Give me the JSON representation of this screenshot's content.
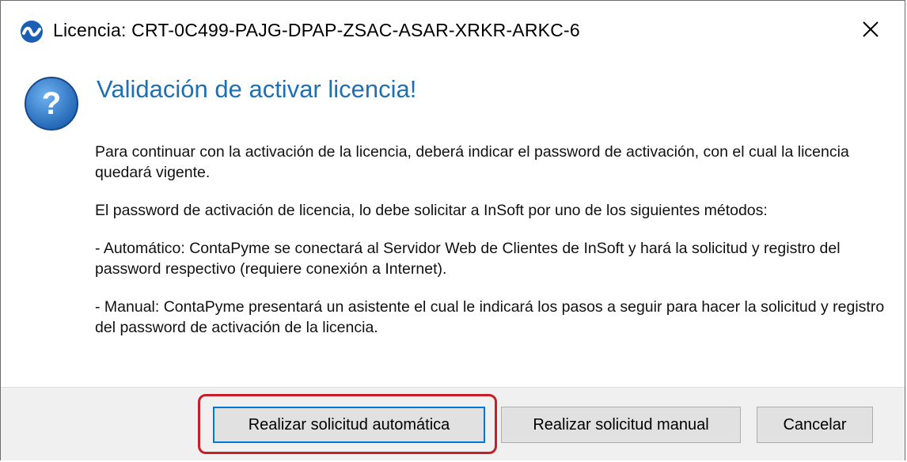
{
  "window": {
    "title": "Licencia: CRT-0C499-PAJG-DPAP-ZSAC-ASAR-XRKR-ARKC-6",
    "app_icon": "app-logo-icon",
    "close_icon": "close-icon"
  },
  "main": {
    "heading": "Validación de activar licencia!",
    "icon": "question-icon",
    "paragraphs": [
      "Para continuar con la activación de la licencia, deberá indicar el password de activación, con el cual la licencia quedará vigente.",
      "El password de activación de licencia, lo debe solicitar a InSoft por uno de los siguientes métodos:",
      "- Automático: ContaPyme se conectará al Servidor Web de Clientes de InSoft y hará la solicitud y registro del password respectivo (requiere conexión a Internet).",
      "- Manual: ContaPyme presentará un asistente el cual le indicará los pasos a seguir para hacer la solicitud y registro del password de activación de la licencia."
    ]
  },
  "footer": {
    "buttons": {
      "auto": "Realizar solicitud automática",
      "manual": "Realizar solicitud manual",
      "cancel": "Cancelar"
    }
  },
  "colors": {
    "heading": "#1e6fb4",
    "highlight": "#c81e28",
    "default_button_border": "#0078d7"
  }
}
